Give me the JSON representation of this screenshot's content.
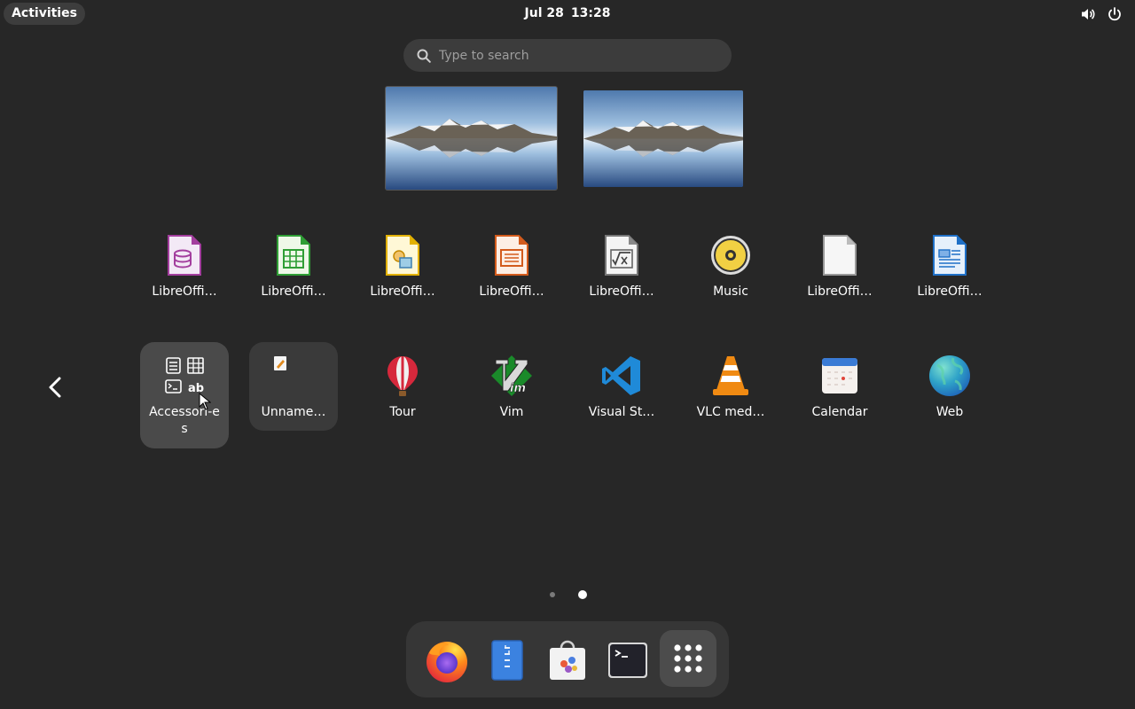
{
  "topbar": {
    "activities": "Activities",
    "date": "Jul 28",
    "time": "13:28",
    "icons": [
      "volume-icon",
      "power-icon"
    ]
  },
  "search": {
    "placeholder": "Type to search"
  },
  "workspaces": [
    {
      "name": "workspace-1"
    },
    {
      "name": "workspace-2"
    }
  ],
  "apps_row1": [
    {
      "label": "LibreOffi…",
      "icon": "libreoffice-base-icon"
    },
    {
      "label": "LibreOffi…",
      "icon": "libreoffice-calc-icon"
    },
    {
      "label": "LibreOffi…",
      "icon": "libreoffice-draw-icon"
    },
    {
      "label": "LibreOffi…",
      "icon": "libreoffice-impress-icon"
    },
    {
      "label": "LibreOffi…",
      "icon": "libreoffice-math-icon"
    },
    {
      "label": "Music",
      "icon": "music-icon"
    },
    {
      "label": "LibreOffi…",
      "icon": "libreoffice-icon"
    },
    {
      "label": "LibreOffi…",
      "icon": "libreoffice-writer-icon"
    }
  ],
  "apps_row2": [
    {
      "label": "Accessori-es",
      "icon": "accessories-folder-icon"
    },
    {
      "label": "Unname…",
      "icon": "unnamed-folder-icon"
    },
    {
      "label": "Tour",
      "icon": "tour-balloon-icon"
    },
    {
      "label": "Vim",
      "icon": "vim-icon"
    },
    {
      "label": "Visual St…",
      "icon": "vscode-icon"
    },
    {
      "label": "VLC med…",
      "icon": "vlc-cone-icon"
    },
    {
      "label": "Calendar",
      "icon": "calendar-icon"
    },
    {
      "label": "Web",
      "icon": "web-globe-icon"
    }
  ],
  "pagination": {
    "pages": 2,
    "current": 2
  },
  "dash": [
    {
      "name": "firefox",
      "icon": "firefox-icon"
    },
    {
      "name": "files",
      "icon": "files-icon"
    },
    {
      "name": "software",
      "icon": "software-bag-icon"
    },
    {
      "name": "terminal",
      "icon": "terminal-icon"
    },
    {
      "name": "show-apps",
      "icon": "app-grid-icon"
    }
  ],
  "colors": {
    "background": "#272727",
    "panel": "#363636",
    "folder": "#3a3a3a"
  }
}
